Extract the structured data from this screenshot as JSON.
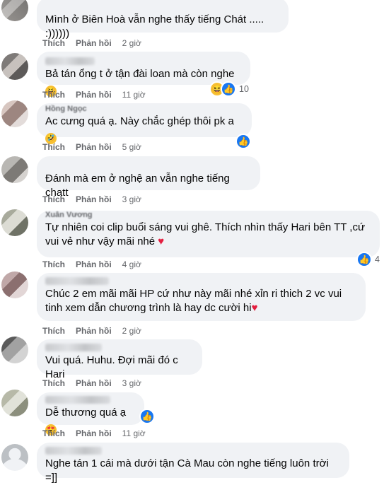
{
  "labels": {
    "like": "Thích",
    "reply": "Phản hồi"
  },
  "comments": [
    {
      "name": "",
      "text": "Mình ở Biên Hoà vẫn nghe thấy tiếng Chát ..... :))))))",
      "time": "2 giờ",
      "reactions": null
    },
    {
      "name": "",
      "text": "Bả tán ổng t ở tận đài loan mà còn nghe",
      "time": "11 giờ",
      "reactions": {
        "icons": [
          "haha-icon",
          "like-icon"
        ],
        "count": "10"
      }
    },
    {
      "name": "Hồng Ngọc",
      "text": "Ac cưng quá ạ. Này chắc ghép thôi pk a",
      "time": "5 giờ",
      "reactions": {
        "icons": [
          "like-icon"
        ],
        "count": ""
      }
    },
    {
      "name": "",
      "text": "Đánh mà em ở nghệ an vẫn nghe tiếng chatt",
      "time": "3 giờ",
      "reactions": null
    },
    {
      "name": "Xuân Vương",
      "text": "Tự nhiên coi clip buổi sáng vui ghê. Thích nhìn thấy Hari bên TT ,cứ vui vẻ như vậy mãi nhé",
      "time": "4 giờ",
      "reactions": {
        "icons": [
          "like-icon"
        ],
        "count": "4"
      }
    },
    {
      "name": "",
      "text": "Chúc 2 em mãi mãi HP cứ như này mãi nhé xỉn ri thich 2 vc vui tinh xem dẫn chương trình là hay dc cười hi",
      "time": "2 giờ",
      "reactions": null
    },
    {
      "name": "",
      "text": "Vui quá. Huhu. Đợi mãi đó c Hari",
      "time": "3 giờ",
      "reactions": null
    },
    {
      "name": "",
      "text": "Dễ thương quá ạ",
      "time": "11 giờ",
      "reactions": null
    },
    {
      "name": "",
      "text": "Nghe tán 1 cái mà dưới tận Cà Mau còn nghe tiếng luôn trời =]]",
      "time": "",
      "reactions": null
    }
  ],
  "colors": {
    "bubble": "#f0f2f5",
    "meta": "#65676b",
    "like_blue": "#1877f2",
    "heart": "#e41e3f"
  }
}
